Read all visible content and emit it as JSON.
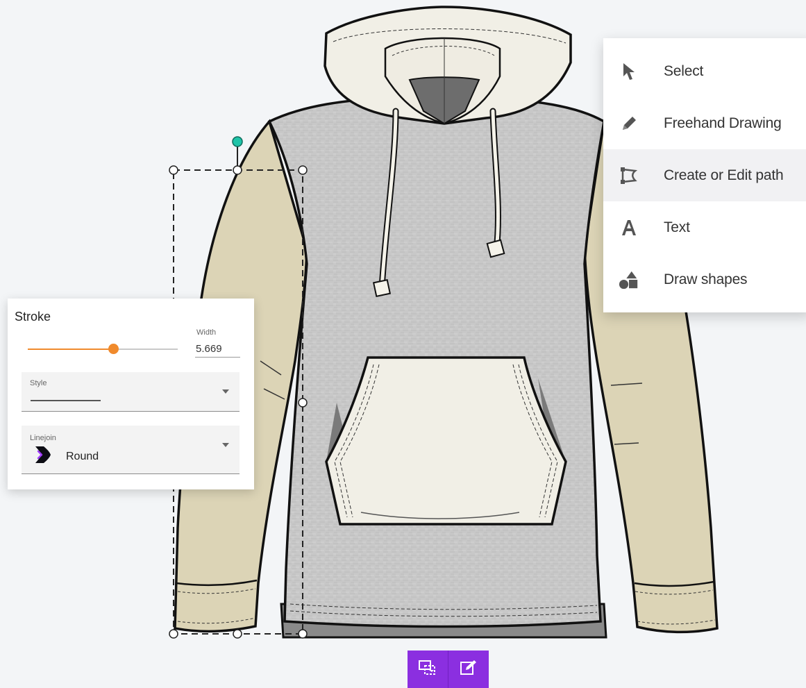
{
  "tool_menu": {
    "items": [
      {
        "label": "Select",
        "icon": "cursor-arrow-icon",
        "active": false
      },
      {
        "label": "Freehand Drawing",
        "icon": "pencil-icon",
        "active": false
      },
      {
        "label": "Create or Edit path",
        "icon": "bezier-path-icon",
        "active": true
      },
      {
        "label": "Text",
        "icon": "text-a-icon",
        "active": false
      },
      {
        "label": "Draw shapes",
        "icon": "shapes-icon",
        "active": false
      }
    ]
  },
  "stroke_panel": {
    "title": "Stroke",
    "slider_fraction": 0.57,
    "width_label": "Width",
    "width_value": "5.669",
    "style_label": "Style",
    "linejoin_label": "Linejoin",
    "linejoin_value": "Round"
  },
  "bottom_toolbar": {
    "buttons": [
      {
        "icon": "transform-select-icon"
      },
      {
        "icon": "edit-note-icon"
      }
    ]
  },
  "colors": {
    "accent_orange": "#f08a2c",
    "toolbar_purple": "#8b2fe0",
    "selection_handle_teal": "#1ec4a8",
    "body_grey": "#c9c9c9",
    "sleeve_beige": "#dcd4b6",
    "pocket_cream": "#f1efe6"
  }
}
